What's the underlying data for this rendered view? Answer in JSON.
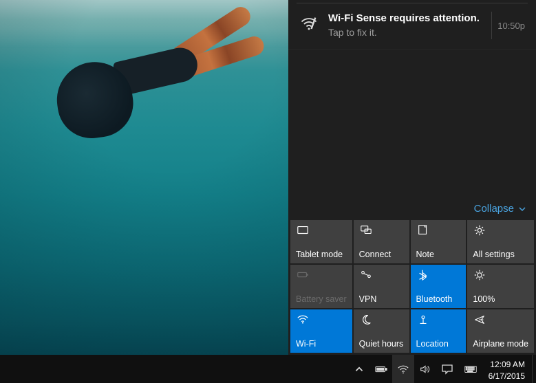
{
  "notification": {
    "title": "Wi-Fi Sense requires attention.",
    "subtitle": "Tap to fix it.",
    "time": "10:50p",
    "icon": "wifi-sense-icon"
  },
  "collapse": {
    "label": "Collapse"
  },
  "tiles": [
    {
      "id": "tablet-mode",
      "label": "Tablet mode",
      "icon": "tablet-icon",
      "state": "normal"
    },
    {
      "id": "connect",
      "label": "Connect",
      "icon": "connect-icon",
      "state": "normal"
    },
    {
      "id": "note",
      "label": "Note",
      "icon": "note-icon",
      "state": "normal"
    },
    {
      "id": "all-settings",
      "label": "All settings",
      "icon": "gear-icon",
      "state": "normal"
    },
    {
      "id": "battery-saver",
      "label": "Battery saver",
      "icon": "battery-icon",
      "state": "disabled"
    },
    {
      "id": "vpn",
      "label": "VPN",
      "icon": "vpn-icon",
      "state": "normal"
    },
    {
      "id": "bluetooth",
      "label": "Bluetooth",
      "icon": "bluetooth-icon",
      "state": "active"
    },
    {
      "id": "brightness",
      "label": "100%",
      "icon": "sun-icon",
      "state": "normal"
    },
    {
      "id": "wifi",
      "label": "Wi-Fi",
      "icon": "wifi-icon",
      "state": "active"
    },
    {
      "id": "quiet-hours",
      "label": "Quiet hours",
      "icon": "moon-icon",
      "state": "normal"
    },
    {
      "id": "location",
      "label": "Location",
      "icon": "location-icon",
      "state": "active"
    },
    {
      "id": "airplane",
      "label": "Airplane mode",
      "icon": "airplane-icon",
      "state": "normal"
    }
  ],
  "taskbar": {
    "time": "12:09 AM",
    "date": "6/17/2015"
  }
}
